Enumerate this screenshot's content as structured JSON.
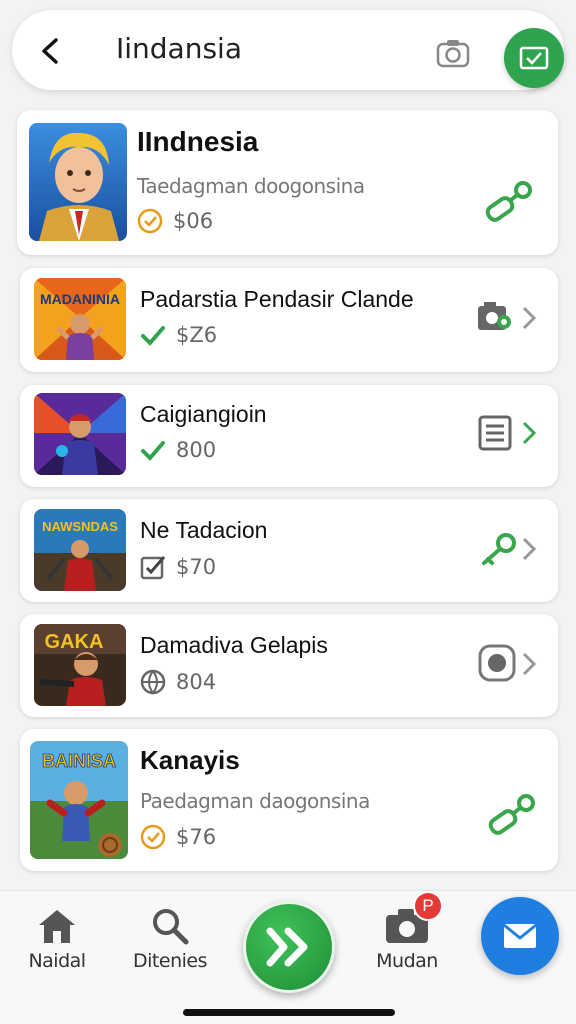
{
  "header": {
    "title": "Iindansia",
    "back_icon": "back-arrow-icon",
    "camera_icon": "camera-icon",
    "mail_icon": "mail-check-icon"
  },
  "items": [
    {
      "title": "IIndnesia",
      "subtitle": "Taedagman doogonsina",
      "price": "$06",
      "status_icon": "check-circle-icon",
      "action_icon": "link-icon"
    },
    {
      "title": "Padarstia Pendasir Clande",
      "price": "$Z6",
      "status_icon": "checkmark-icon",
      "action_icon": "camera-settings-icon",
      "thumb_text": "MADANINIA"
    },
    {
      "title": "Caigiangioin",
      "price": "800",
      "status_icon": "checkmark-icon",
      "action_icon": "document-icon"
    },
    {
      "title": "Ne Tadacion",
      "price": "$70",
      "status_icon": "edit-check-icon",
      "action_icon": "key-icon",
      "thumb_text": "NAWSNDAS"
    },
    {
      "title": "Damadiva Gelapis",
      "price": "804",
      "status_icon": "globe-icon",
      "action_icon": "record-icon",
      "thumb_text": "GAKA"
    },
    {
      "title": "Kanayis",
      "subtitle": "Paedagman daogonsina",
      "price": "$76",
      "status_icon": "check-circle-icon",
      "action_icon": "link-icon",
      "thumb_text": "BAINISA"
    }
  ],
  "nav": {
    "home": "Naidal",
    "search": "Ditenies",
    "camera": "Mudan",
    "badge": "P"
  },
  "colors": {
    "accent_green": "#2ea44f",
    "accent_blue": "#1f7fe0",
    "badge_red": "#e53935",
    "check_orange": "#e89a1a"
  }
}
